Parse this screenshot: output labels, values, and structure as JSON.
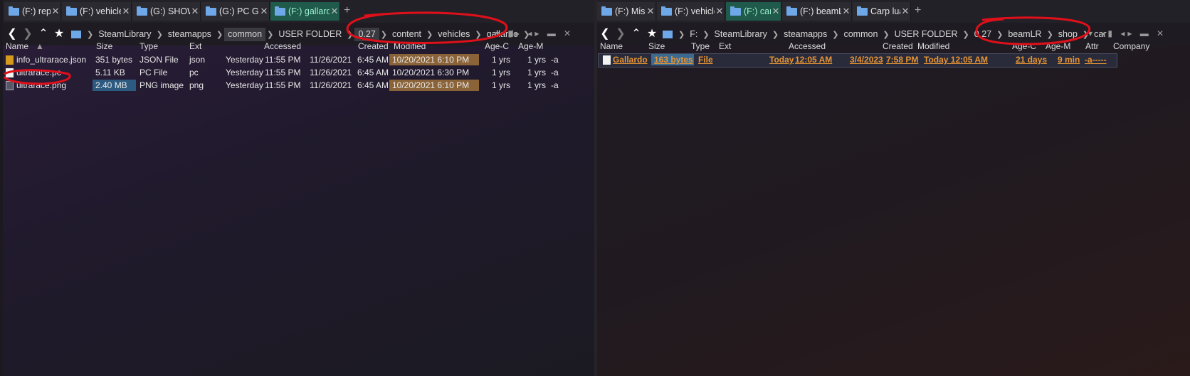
{
  "left": {
    "tabs": [
      {
        "label": "(F:) repo"
      },
      {
        "label": "(F:) vehicles"
      },
      {
        "label": "(G:) SHOWS"
      },
      {
        "label": "(G:) PC Gar"
      },
      {
        "label": "(F:) gallardo"
      }
    ],
    "breadcrumb": [
      "SteamLibrary",
      "steamapps",
      "common",
      "USER FOLDER",
      "0.27",
      "content",
      "vehicles",
      "gallardo"
    ],
    "columns": [
      "Name",
      "Size",
      "Type",
      "Ext",
      "Accessed",
      "Created",
      "Modified",
      "Age-C",
      "Age-M"
    ],
    "rows": [
      {
        "name": "info_ultrarace.json",
        "size": "351 bytes",
        "type": "JSON File",
        "ext": "json",
        "acc_day": "Yesterday",
        "acc_time": "11:55 PM",
        "created_date": "11/26/2021",
        "created_time": "6:45 AM",
        "modified": "10/20/2021 6:10 PM",
        "agec": "1 yrs",
        "agem": "1 yrs",
        "attr": "-a"
      },
      {
        "name": "ultrarace.pc",
        "size": "5.11 KB",
        "type": "PC File",
        "ext": "pc",
        "acc_day": "Yesterday",
        "acc_time": "11:55 PM",
        "created_date": "11/26/2021",
        "created_time": "6:45 AM",
        "modified": "10/20/2021 6:30 PM",
        "agec": "1 yrs",
        "agem": "1 yrs",
        "attr": "-a"
      },
      {
        "name": "ultrarace.png",
        "size": "2.40 MB",
        "type": "PNG image",
        "ext": "png",
        "acc_day": "Yesterday",
        "acc_time": "11:55 PM",
        "created_date": "11/26/2021",
        "created_time": "6:45 AM",
        "modified": "10/20/2021 6:10 PM",
        "agec": "1 yrs",
        "agem": "1 yrs",
        "attr": "-a"
      }
    ]
  },
  "right": {
    "tabs": [
      {
        "label": "(F:) Misc"
      },
      {
        "label": "(F:) vehicles"
      },
      {
        "label": "(F:) car"
      },
      {
        "label": "(F:) beamLr"
      },
      {
        "label": "Carp lua"
      }
    ],
    "breadcrumb": [
      "F:",
      "SteamLibrary",
      "steamapps",
      "common",
      "USER FOLDER",
      "0.27",
      "beamLR",
      "shop",
      "car"
    ],
    "columns": [
      "Name",
      "Size",
      "Type",
      "Ext",
      "Accessed",
      "Created",
      "Modified",
      "Age-C",
      "Age-M",
      "Attr",
      "Company"
    ],
    "rows": [
      {
        "name": "Gallardo",
        "size": "163 bytes",
        "type": "File",
        "acc_day": "Today",
        "acc_time": "12:05 AM",
        "created_date": "3/4/2023",
        "created_time": "7:58 PM",
        "modified": "Today 12:05 AM",
        "agec": "21 days",
        "agem": "9 min",
        "attr": "-a-----"
      }
    ]
  },
  "colors": {
    "annotation": "#e0101a",
    "accent_tab": "#1f5a4a",
    "link_orange": "#e69535"
  }
}
